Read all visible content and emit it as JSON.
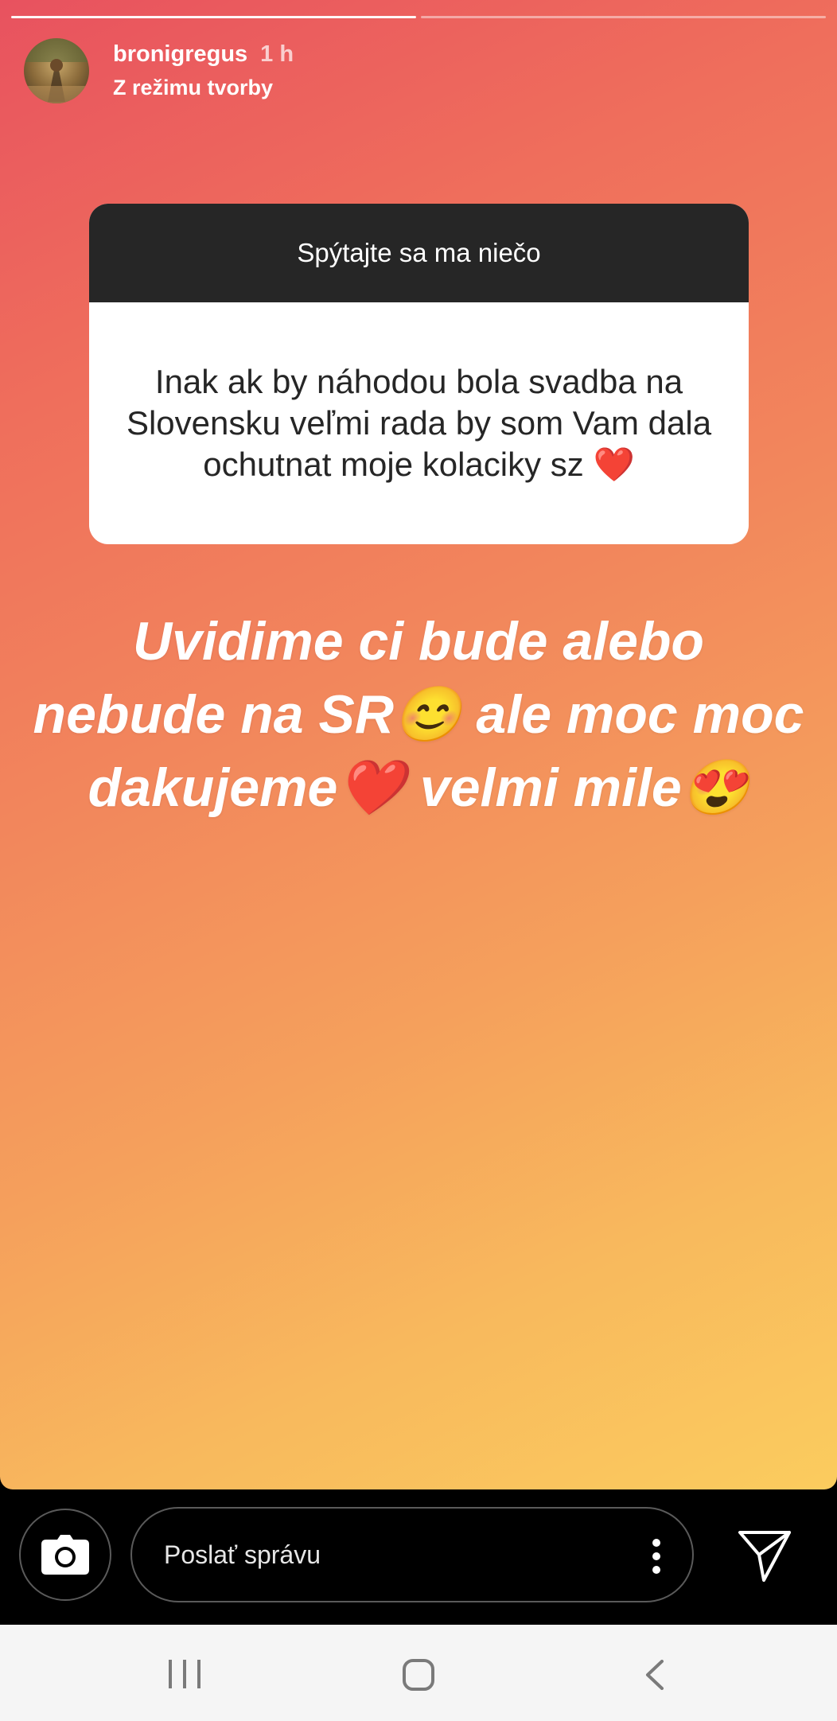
{
  "story": {
    "username": "bronigregus",
    "time": "1 h",
    "subtitle": "Z režimu tvorby",
    "question": {
      "prompt": "Spýtajte sa ma niečo",
      "text": "Inak ak by náhodou bola svadba na Slovensku veľmi rada by som Vam dala ochutnat moje kolaciky sz ❤️"
    },
    "answer": "Uvidime ci bude alebo nebude na SR😊 ale moc moc dakujeme❤️ velmi mile😍"
  },
  "composer": {
    "placeholder": "Poslať správu"
  },
  "colors": {
    "gradient_start": "#e8525f",
    "gradient_end": "#fbcc5e",
    "question_header": "#262626"
  },
  "icons": {
    "camera": "camera-icon",
    "more": "more-vertical-icon",
    "send": "send-icon",
    "recent_apps": "recent-apps-icon",
    "home": "home-icon",
    "back": "back-icon"
  }
}
